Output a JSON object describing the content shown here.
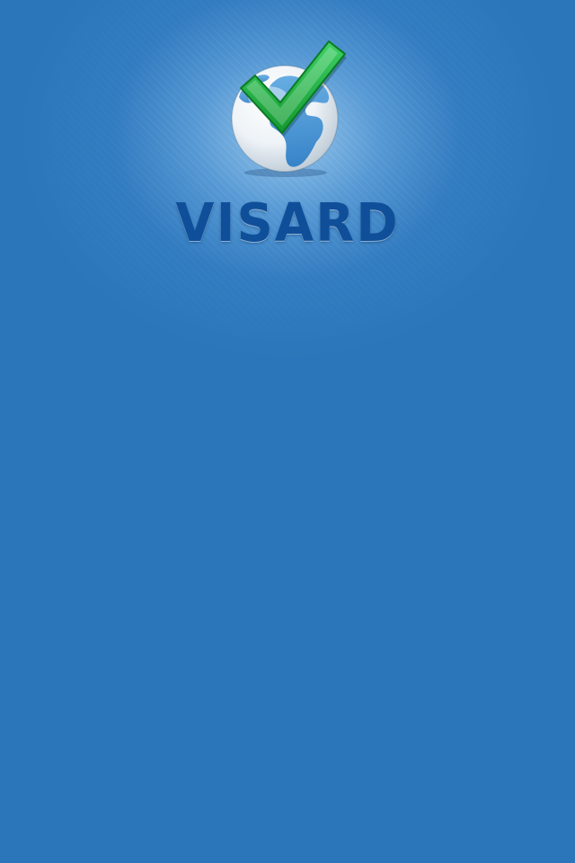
{
  "app": {
    "name": "VISARD"
  },
  "logo": {
    "icon": "globe-with-checkmark-icon"
  },
  "colors": {
    "background": "#2b76ba",
    "wordmark": "#0f4f9a",
    "checkmark": "#1fb24a"
  }
}
